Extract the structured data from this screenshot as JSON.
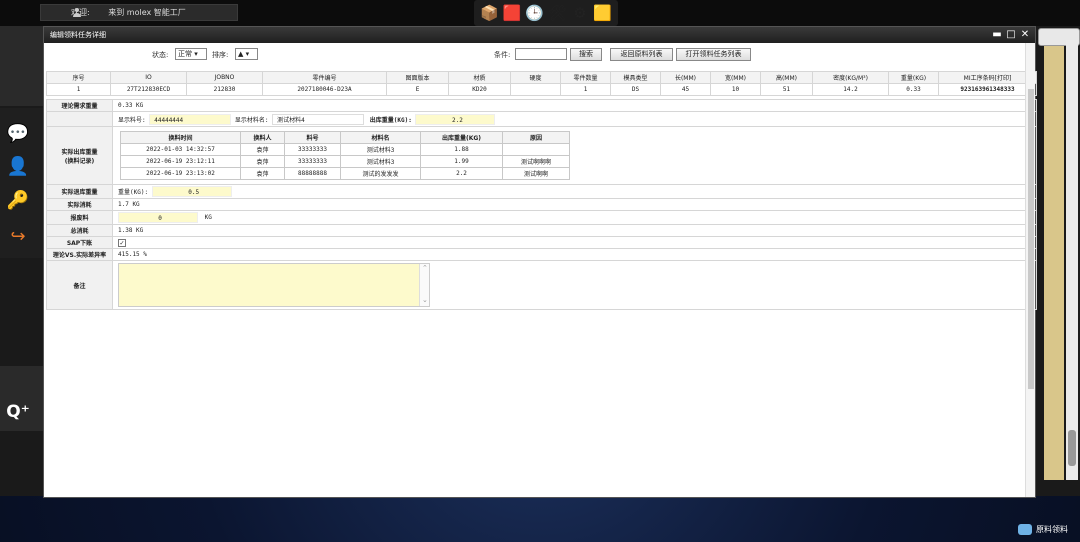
{
  "topbar": {
    "welcome_label": "欢迎:",
    "welcome_text": "来到 molex 智能工厂",
    "tools": [
      {
        "icon": "box-icon",
        "glyph": "📦"
      },
      {
        "icon": "red-cube-icon",
        "glyph": "🟥"
      },
      {
        "icon": "clock-document-icon",
        "glyph": "🕒"
      },
      {
        "icon": "tools-icon",
        "glyph": "🛠"
      },
      {
        "icon": "gears-icon",
        "glyph": "⚙"
      },
      {
        "icon": "gold-cube-icon",
        "glyph": "🟨"
      }
    ]
  },
  "sidebar": {
    "icons": [
      {
        "name": "chat-icon",
        "glyph": "💬"
      },
      {
        "name": "user-icon",
        "glyph": "👤"
      },
      {
        "name": "key-icon",
        "glyph": "🔑"
      },
      {
        "name": "arrow-icon",
        "glyph": "↪"
      },
      {
        "name": "q-plus-icon",
        "glyph": "Q⁺"
      }
    ]
  },
  "modal": {
    "title": "编辑领料任务详细",
    "minimize": "▬",
    "maximize": "□",
    "close": "✕",
    "status_label": "状态:",
    "status_value": "正常 ▾",
    "sort_label": "排序:",
    "sort_value": "▲ ▾",
    "condition_label": "条件:",
    "condition_value": "",
    "search_button": "搜索",
    "back_button": "返回原料列表",
    "open_button": "打开领料任务列表"
  },
  "grid": {
    "headers": [
      "序号",
      "IO",
      "JOBNO",
      "零件编号",
      "图面版本",
      "材质",
      "硬度",
      "零件数量",
      "模具类型",
      "长(MM)",
      "宽(MM)",
      "高(MM)",
      "密度(KG/M³)",
      "重量(KG)",
      "MI工序条码[打印]"
    ],
    "row": [
      "1",
      "27T212830ECD",
      "212830",
      "2027180046-D23A",
      "E",
      "KD20",
      "",
      "1",
      "DS",
      "45",
      "10",
      "51",
      "14.2",
      "0.33",
      "923163961348333"
    ]
  },
  "detail": {
    "theory_label": "理论需求重量",
    "theory_value": "0.33 KG",
    "display_code_label": "显示料号:",
    "display_code_value": "44444444",
    "display_name_label": "显示材料名:",
    "display_name_value": "测试材料4",
    "out_weight_label": "出库重量(KG):",
    "out_weight_value": "2.2",
    "actual_out_label_1": "实际出库重量",
    "actual_out_label_2": "(换料记录)",
    "history": {
      "headers": [
        "换料时间",
        "换料人",
        "料号",
        "材料名",
        "出库重量(KG)",
        "原因"
      ],
      "rows": [
        [
          "2022-01-03 14:32:57",
          "袁萍",
          "33333333",
          "测试材料3",
          "1.88",
          ""
        ],
        [
          "2022-06-19 23:12:11",
          "袁萍",
          "33333333",
          "测试材料3",
          "1.99",
          "测试啊啊啊"
        ],
        [
          "2022-06-19 23:13:02",
          "袁萍",
          "88888888",
          "测试的发发发",
          "2.2",
          "测试啊啊"
        ]
      ]
    },
    "return_label": "实际退库重量",
    "return_weight_label": "重量(KG):",
    "return_weight_value": "0.5",
    "consume_label": "实际消耗",
    "consume_value": "1.7 KG",
    "scrap_label": "报废料",
    "scrap_value": "0",
    "scrap_unit": "KG",
    "total_label": "总消耗",
    "total_value": "1.38 KG",
    "sap_label": "SAP下账",
    "sap_checked": "✓",
    "diff_label": "理论VS.实际差异率",
    "diff_value": "415.15 %",
    "remark_label": "备注",
    "remark_value": ""
  },
  "dock": {
    "label": "原料领料"
  }
}
